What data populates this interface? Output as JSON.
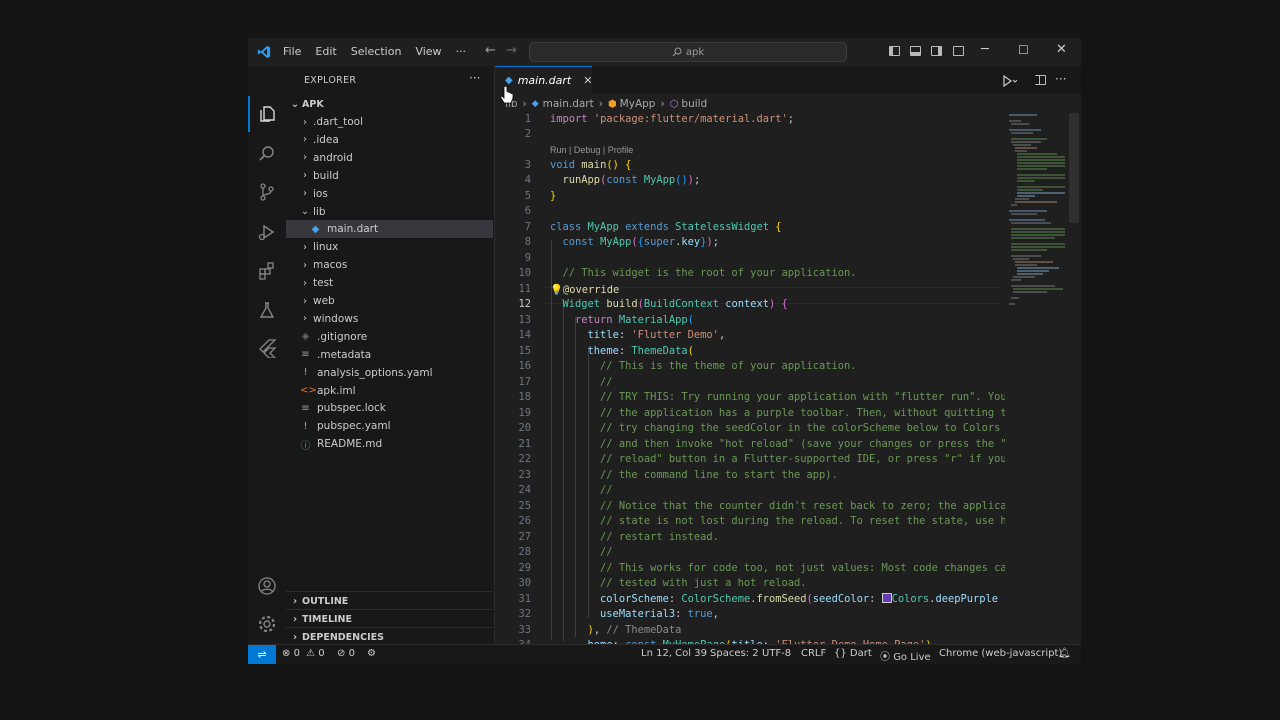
{
  "titlebar": {
    "menus": [
      "File",
      "Edit",
      "Selection",
      "View",
      "···"
    ],
    "search_text": "apk"
  },
  "sidebar": {
    "title": "EXPLORER",
    "more": "···",
    "root": "APK",
    "tree": [
      {
        "label": ".dart_tool",
        "kind": "folder",
        "open": false
      },
      {
        "label": ".idea",
        "kind": "folder",
        "open": false
      },
      {
        "label": "android",
        "kind": "folder",
        "open": false
      },
      {
        "label": "build",
        "kind": "folder",
        "open": false
      },
      {
        "label": "ios",
        "kind": "folder",
        "open": false
      },
      {
        "label": "lib",
        "kind": "folder",
        "open": true
      },
      {
        "label": "main.dart",
        "kind": "dart",
        "selected": true
      },
      {
        "label": "linux",
        "kind": "folder",
        "open": false
      },
      {
        "label": "macos",
        "kind": "folder",
        "open": false
      },
      {
        "label": "test",
        "kind": "folder",
        "open": false
      },
      {
        "label": "web",
        "kind": "folder",
        "open": false
      },
      {
        "label": "windows",
        "kind": "folder",
        "open": false
      },
      {
        "label": ".gitignore",
        "kind": "git"
      },
      {
        "label": ".metadata",
        "kind": "meta"
      },
      {
        "label": "analysis_options.yaml",
        "kind": "yaml"
      },
      {
        "label": "apk.iml",
        "kind": "xml"
      },
      {
        "label": "pubspec.lock",
        "kind": "lock"
      },
      {
        "label": "pubspec.yaml",
        "kind": "yaml"
      },
      {
        "label": "README.md",
        "kind": "info"
      }
    ],
    "sections": [
      "OUTLINE",
      "TIMELINE",
      "DEPENDENCIES"
    ]
  },
  "editor": {
    "tab_label": "main.dart",
    "breadcrumb": {
      "seg1": "lib",
      "seg2": "main.dart",
      "seg3": "MyApp",
      "seg4": "build"
    },
    "code_lens": "Run | Debug | Profile",
    "current_line": 12
  },
  "statusbar": {
    "errors": "0",
    "warnings": "0",
    "ports": "0",
    "position": "Ln 12, Col 39",
    "spaces": "Spaces: 2",
    "encoding": "UTF-8",
    "eol": "CRLF",
    "language": "Dart",
    "golive": "Go Live",
    "device": "Chrome (web-javascript)"
  },
  "colors": {
    "accent": "#0078d4",
    "dart_icon": "#42a5f5",
    "yaml_icon": "#c586c0"
  }
}
